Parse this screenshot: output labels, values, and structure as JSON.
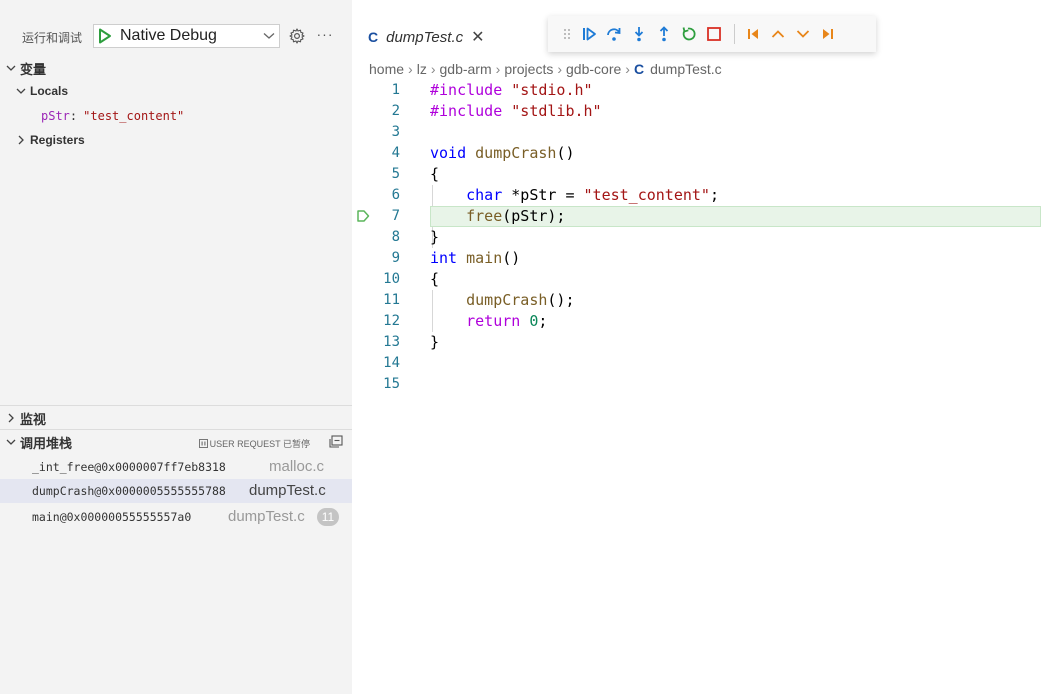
{
  "run_bar": {
    "title": "运行和调试",
    "config": "Native Debug"
  },
  "variables": {
    "header": "变量",
    "locals_label": "Locals",
    "local_var": {
      "name": "pStr",
      "value": "\"test_content\""
    },
    "registers_label": "Registers"
  },
  "watch": {
    "header": "监视"
  },
  "callstack": {
    "header": "调用堆栈",
    "pause_reason": "USER REQUEST 已暂停",
    "frames": [
      {
        "name": "_int_free@0x0000007ff7eb8318",
        "file": "malloc.c"
      },
      {
        "name": "dumpCrash@0x0000005555555788",
        "file": "dumpTest.c"
      },
      {
        "name": "main@0x00000055555557a0",
        "file": "dumpTest.c",
        "line": "11"
      }
    ]
  },
  "editor": {
    "tab_label": "dumpTest.c",
    "breadcrumb": [
      "home",
      "lz",
      "gdb-arm",
      "projects",
      "gdb-core"
    ],
    "breadcrumb_file": "dumpTest.c",
    "current_line": 7,
    "lines": [
      "#include \"stdio.h\"",
      "#include \"stdlib.h\"",
      "",
      "void dumpCrash()",
      "{",
      "    char *pStr = \"test_content\";",
      "    free(pStr);",
      "}",
      "int main()",
      "{",
      "    dumpCrash();",
      "    return 0;",
      "}",
      "",
      ""
    ],
    "line_numbers": [
      "1",
      "2",
      "3",
      "4",
      "5",
      "6",
      "7",
      "8",
      "9",
      "10",
      "11",
      "12",
      "13",
      "14",
      "15"
    ]
  },
  "colors": {
    "accent_blue": "#1a4fa0",
    "debug_blue": "#1e7bd6",
    "debug_orange": "#e8861a",
    "stop_red": "#d93025",
    "current_line_bg": "#e8f4e8"
  },
  "icons": {
    "debug_toolbar": [
      "drag-grip-icon",
      "continue-icon",
      "step-over-icon",
      "step-into-icon",
      "step-out-icon",
      "restart-icon",
      "stop-icon",
      "jump-start-icon",
      "frame-up-icon",
      "frame-down-icon",
      "jump-end-icon"
    ]
  }
}
